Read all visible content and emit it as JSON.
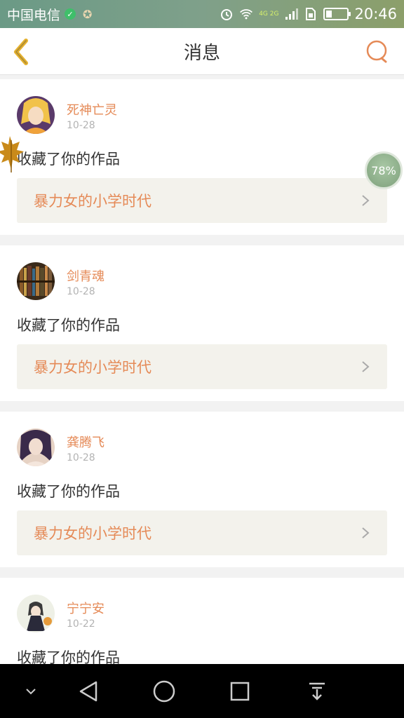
{
  "status_bar": {
    "carrier": "中国电信",
    "time": "20:46",
    "network": "4G 2G",
    "icons": [
      "shield-check-icon",
      "star-icon",
      "alarm-icon",
      "wifi-icon",
      "signal-icon",
      "sim-icon",
      "battery-icon"
    ]
  },
  "header": {
    "title": "消息",
    "back_icon": "chevron-left-icon",
    "search_icon": "search-icon",
    "accent_color": "#e58a57"
  },
  "messages": [
    {
      "username": "死神亡灵",
      "date": "10-28",
      "action": "收藏了你的作品",
      "work_title": "暴力女的小学时代"
    },
    {
      "username": "剑青魂",
      "date": "10-28",
      "action": "收藏了你的作品",
      "work_title": "暴力女的小学时代"
    },
    {
      "username": "龚腾飞",
      "date": "10-28",
      "action": "收藏了你的作品",
      "work_title": "暴力女的小学时代"
    },
    {
      "username": "宁宁安",
      "date": "10-22",
      "action": "收藏了你的作品",
      "work_title": ""
    }
  ],
  "floating": {
    "memory_percent": "78%",
    "leaf_icon": "maple-leaf-icon"
  },
  "navbar": {
    "buttons": [
      "collapse-icon",
      "back-triangle-icon",
      "home-circle-icon",
      "recents-square-icon",
      "notification-pull-icon"
    ]
  }
}
